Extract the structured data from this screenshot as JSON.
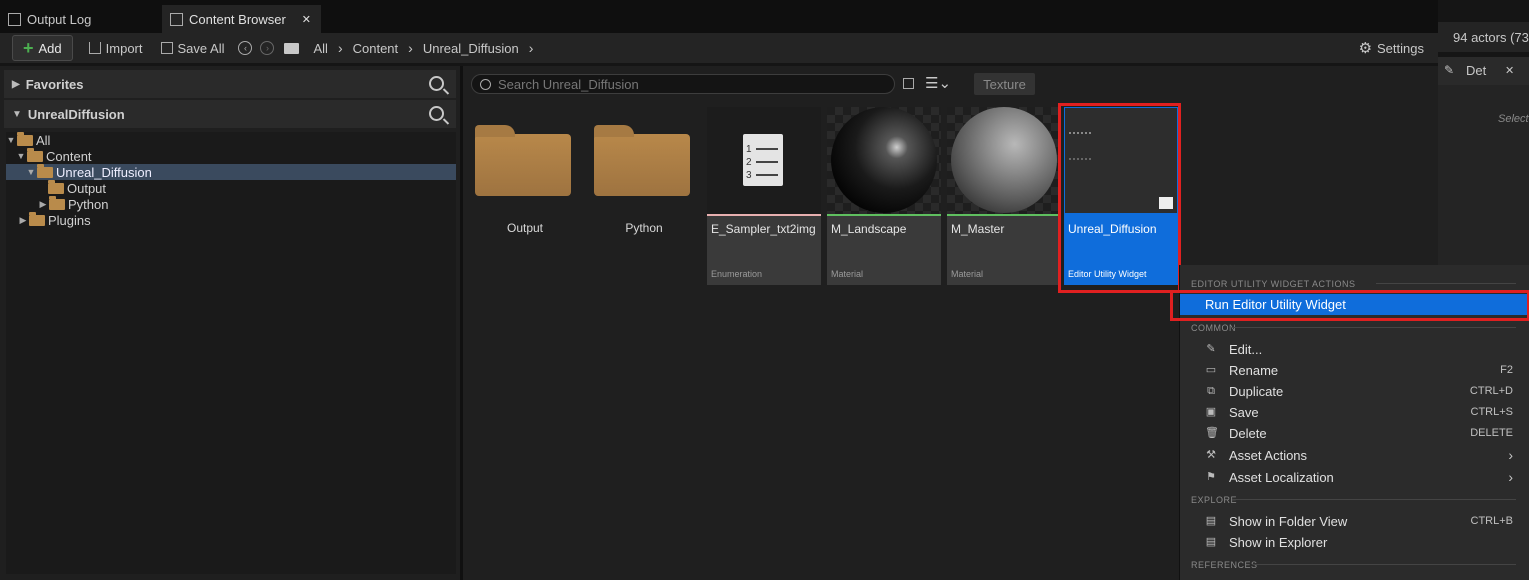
{
  "tabs": {
    "output_log": "Output Log",
    "content_browser": "Content Browser",
    "close": "✕"
  },
  "toolbar": {
    "add": "Add",
    "import": "Import",
    "save_all": "Save All",
    "settings": "Settings",
    "breadcrumb": [
      "All",
      "Content",
      "Unreal_Diffusion"
    ]
  },
  "sidebar": {
    "favorites": "Favorites",
    "project": "UnrealDiffusion",
    "tree": [
      {
        "label": "All"
      },
      {
        "label": "Content"
      },
      {
        "label": "Unreal_Diffusion",
        "selected": true
      },
      {
        "label": "Output"
      },
      {
        "label": "Python"
      },
      {
        "label": "Plugins"
      }
    ]
  },
  "main": {
    "search_placeholder": "Search Unreal_Diffusion",
    "filter_chip": "Texture",
    "folders": [
      {
        "name": "Output"
      },
      {
        "name": "Python"
      }
    ],
    "assets": [
      {
        "name": "E_Sampler_txt2img",
        "type": "Enumeration",
        "bar_color": "#e8b0b0"
      },
      {
        "name": "M_Landscape",
        "type": "Material",
        "bar_color": "#5fbf5f"
      },
      {
        "name": "M_Master",
        "type": "Material",
        "bar_color": "#5fbf5f"
      },
      {
        "name": "Unreal_Diffusion",
        "type": "Editor Utility Widget",
        "bar_color": "#0f6ddb"
      }
    ],
    "enum_lines": [
      "1",
      "2",
      "3"
    ]
  },
  "right_panel": {
    "actors": "94 actors (73",
    "details_tab": "Det",
    "details_close": "✕",
    "select_hint": "Select"
  },
  "context_menu": {
    "headers": {
      "widget_actions": "EDITOR UTILITY WIDGET ACTIONS",
      "common": "COMMON",
      "explore": "EXPLORE",
      "references": "REFERENCES"
    },
    "run": "Run Editor Utility Widget",
    "common_items": [
      {
        "label": "Edit...",
        "shortcut": ""
      },
      {
        "label": "Rename",
        "shortcut": "F2"
      },
      {
        "label": "Duplicate",
        "shortcut": "CTRL+D"
      },
      {
        "label": "Save",
        "shortcut": "CTRL+S"
      },
      {
        "label": "Delete",
        "shortcut": "DELETE"
      },
      {
        "label": "Asset Actions",
        "shortcut": ""
      },
      {
        "label": "Asset Localization",
        "shortcut": ""
      }
    ],
    "explore_items": [
      {
        "label": "Show in Folder View",
        "shortcut": "CTRL+B"
      },
      {
        "label": "Show in Explorer",
        "shortcut": ""
      }
    ]
  }
}
